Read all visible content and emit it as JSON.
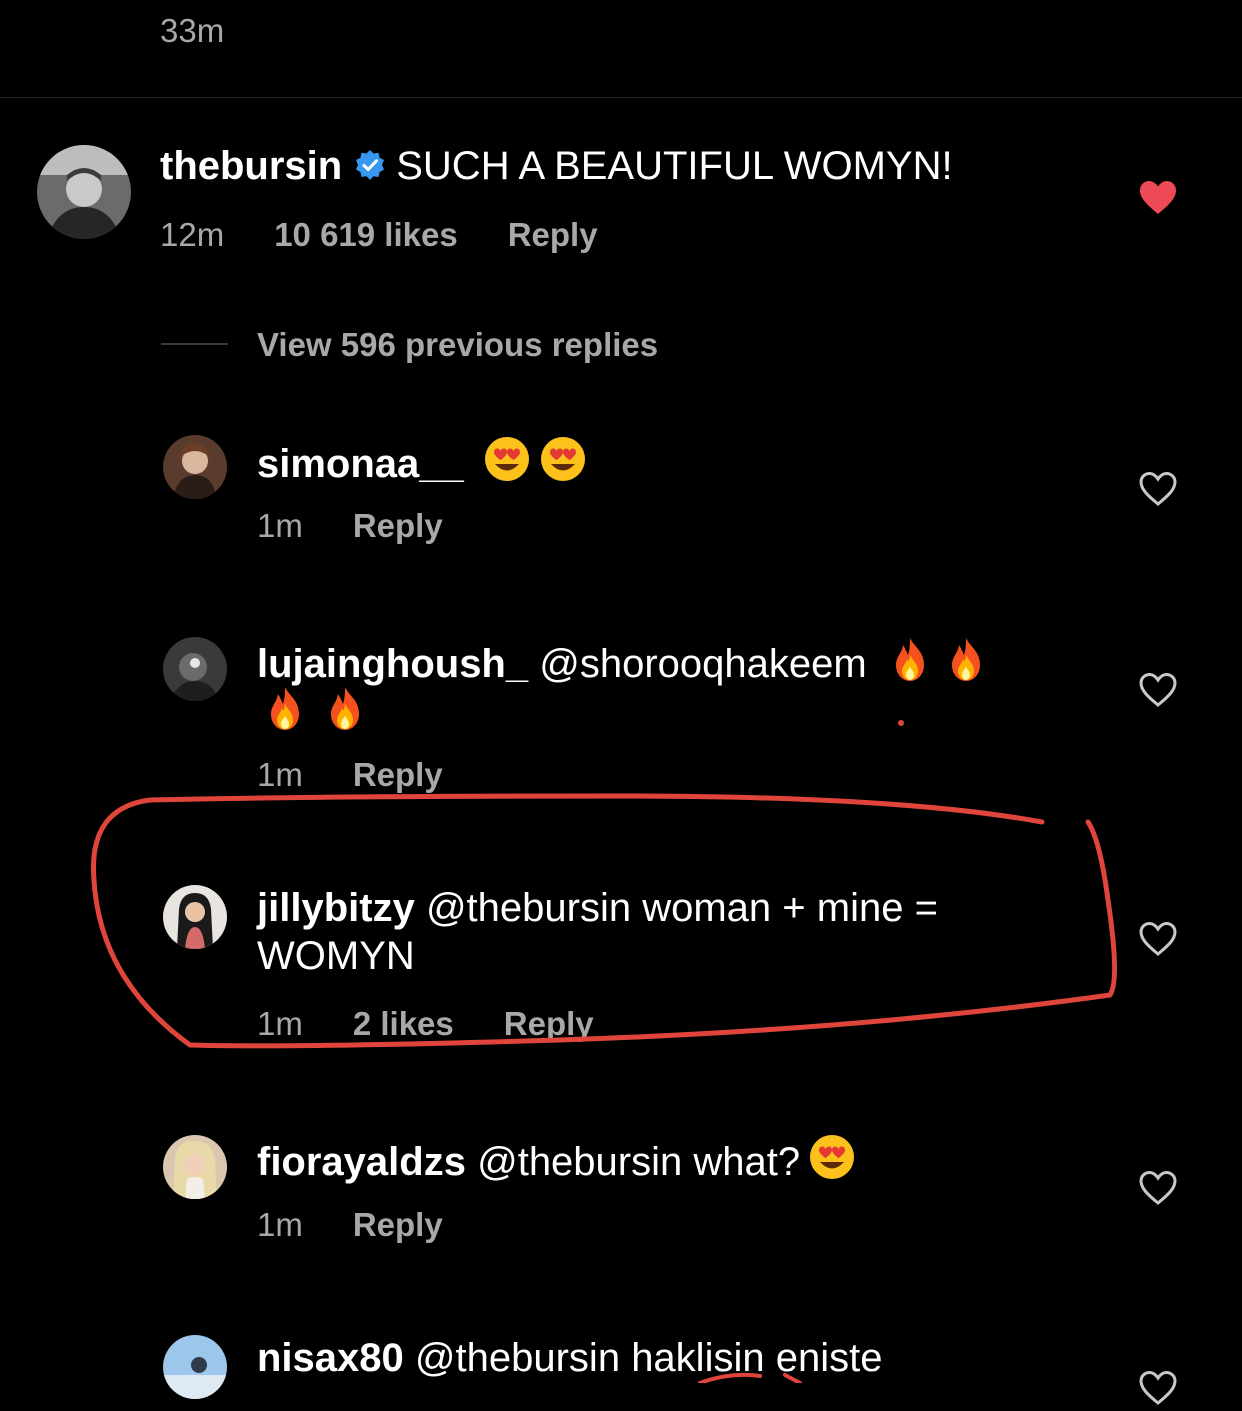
{
  "top": {
    "timestamp": "33m"
  },
  "main_comment": {
    "username": "thebursin",
    "text": "SUCH A BEAUTIFUL WOMYN!",
    "time": "12m",
    "likes": "10 619 likes",
    "reply": "Reply",
    "liked": true,
    "heart_color": "#ed4956"
  },
  "view_replies": {
    "label": "View 596 previous replies"
  },
  "replies": [
    {
      "username": "simonaa__",
      "text": "",
      "time": "1m",
      "reply": "Reply"
    },
    {
      "username": "lujainghoush_",
      "mention": "@shorooqhakeem",
      "time": "1m",
      "reply": "Reply"
    },
    {
      "username": "jillybitzy",
      "mention": "@thebursin",
      "text": "woman + mine =",
      "text2": "WOMYN",
      "time": "1m",
      "likes": "2 likes",
      "reply": "Reply"
    },
    {
      "username": "fiorayaldzs",
      "mention": "@thebursin",
      "text": "what?",
      "time": "1m",
      "reply": "Reply"
    },
    {
      "username": "nisax80",
      "mention": "@thebursin",
      "text": "haklisin eniste"
    }
  ],
  "annotation": {
    "color": "#e0453c"
  }
}
